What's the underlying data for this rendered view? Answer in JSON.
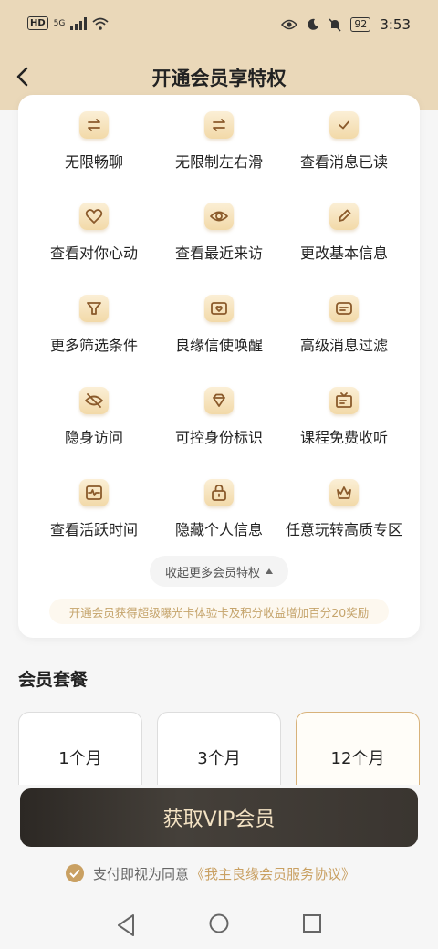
{
  "status": {
    "time": "3:53",
    "battery": "92",
    "hd": "HD",
    "network": "5G"
  },
  "header": {
    "title": "开通会员享特权"
  },
  "privileges": [
    {
      "label": "无限畅聊",
      "icon": "swap-arrows-icon"
    },
    {
      "label": "无限制左右滑",
      "icon": "swap-arrows-icon"
    },
    {
      "label": "查看消息已读",
      "icon": "check-message-icon"
    },
    {
      "label": "查看对你心动",
      "icon": "heart-icon"
    },
    {
      "label": "查看最近来访",
      "icon": "eye-icon"
    },
    {
      "label": "更改基本信息",
      "icon": "pencil-icon"
    },
    {
      "label": "更多筛选条件",
      "icon": "filter-icon"
    },
    {
      "label": "良缘信使唤醒",
      "icon": "heart-envelope-icon"
    },
    {
      "label": "高级消息过滤",
      "icon": "message-lines-icon"
    },
    {
      "label": "隐身访问",
      "icon": "eye-off-icon"
    },
    {
      "label": "可控身份标识",
      "icon": "diamond-icon"
    },
    {
      "label": "课程免费收听",
      "icon": "tv-icon"
    },
    {
      "label": "查看活跃时间",
      "icon": "pulse-icon"
    },
    {
      "label": "隐藏个人信息",
      "icon": "lock-icon"
    },
    {
      "label": "任意玩转高质专区",
      "icon": "crown-icon"
    }
  ],
  "collapse_label": "收起更多会员特权",
  "bonus_note": "开通会员获得超级曝光卡体验卡及积分收益增加百分20奖励",
  "plans_title": "会员套餐",
  "plans": [
    {
      "label": "1个月",
      "selected": false
    },
    {
      "label": "3个月",
      "selected": false
    },
    {
      "label": "12个月",
      "selected": true
    }
  ],
  "cta_label": "获取VIP会员",
  "agreement": {
    "prefix": "支付即视为同意",
    "link": "《我主良缘会员服务协议》"
  },
  "colors": {
    "header_bg": "#ead8b9",
    "accent_gold": "#c9a062",
    "cta_bg": "#2c2824"
  }
}
